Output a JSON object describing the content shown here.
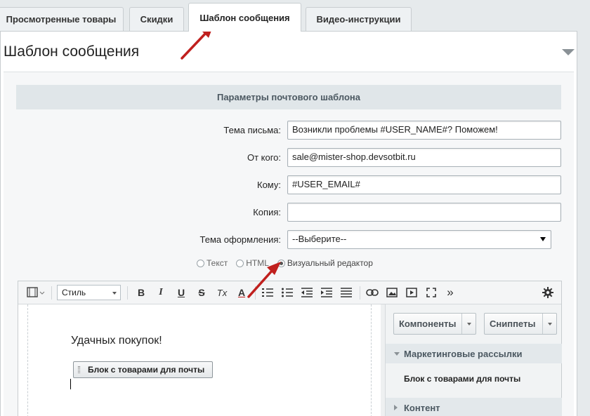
{
  "tabs": [
    {
      "label": "Просмотренные товары",
      "active": false
    },
    {
      "label": "Скидки",
      "active": false
    },
    {
      "label": "Шаблон сообщения",
      "active": true
    },
    {
      "label": "Видео-инструкции",
      "active": false
    }
  ],
  "panel": {
    "title": "Шаблон сообщения"
  },
  "section": {
    "title": "Параметры почтового шаблона"
  },
  "form": {
    "subject_label": "Тема письма:",
    "subject_value": "Возникли проблемы #USER_NAME#? Поможем!",
    "from_label": "От кого:",
    "from_value": "sale@mister-shop.devsotbit.ru",
    "to_label": "Кому:",
    "to_value": "#USER_EMAIL#",
    "copy_label": "Копия:",
    "copy_value": "",
    "theme_label": "Тема оформления:",
    "theme_value": "--Выберите--"
  },
  "format_options": [
    {
      "label": "Текст",
      "checked": false
    },
    {
      "label": "HTML",
      "checked": false
    },
    {
      "label": "Визуальный редактор",
      "checked": true
    }
  ],
  "toolbar": {
    "style_label": "Стиль",
    "bold": "B",
    "italic": "I",
    "underline": "U",
    "strike": "S",
    "clear_format": "Tx",
    "font_color": "A",
    "more": "»"
  },
  "editor": {
    "greeting": "Удачных покупок!",
    "block_label": "Блок с товарами для почты"
  },
  "side": {
    "components_button": "Компоненты",
    "snippets_button": "Сниппеты",
    "group_marketing": "Маркетинговые рассылки",
    "group_marketing_item": "Блок с товарами для почты",
    "group_content": "Контент"
  },
  "colors": {
    "annotation_arrow": "#c0201e",
    "section_bg": "#e0e6e9"
  }
}
